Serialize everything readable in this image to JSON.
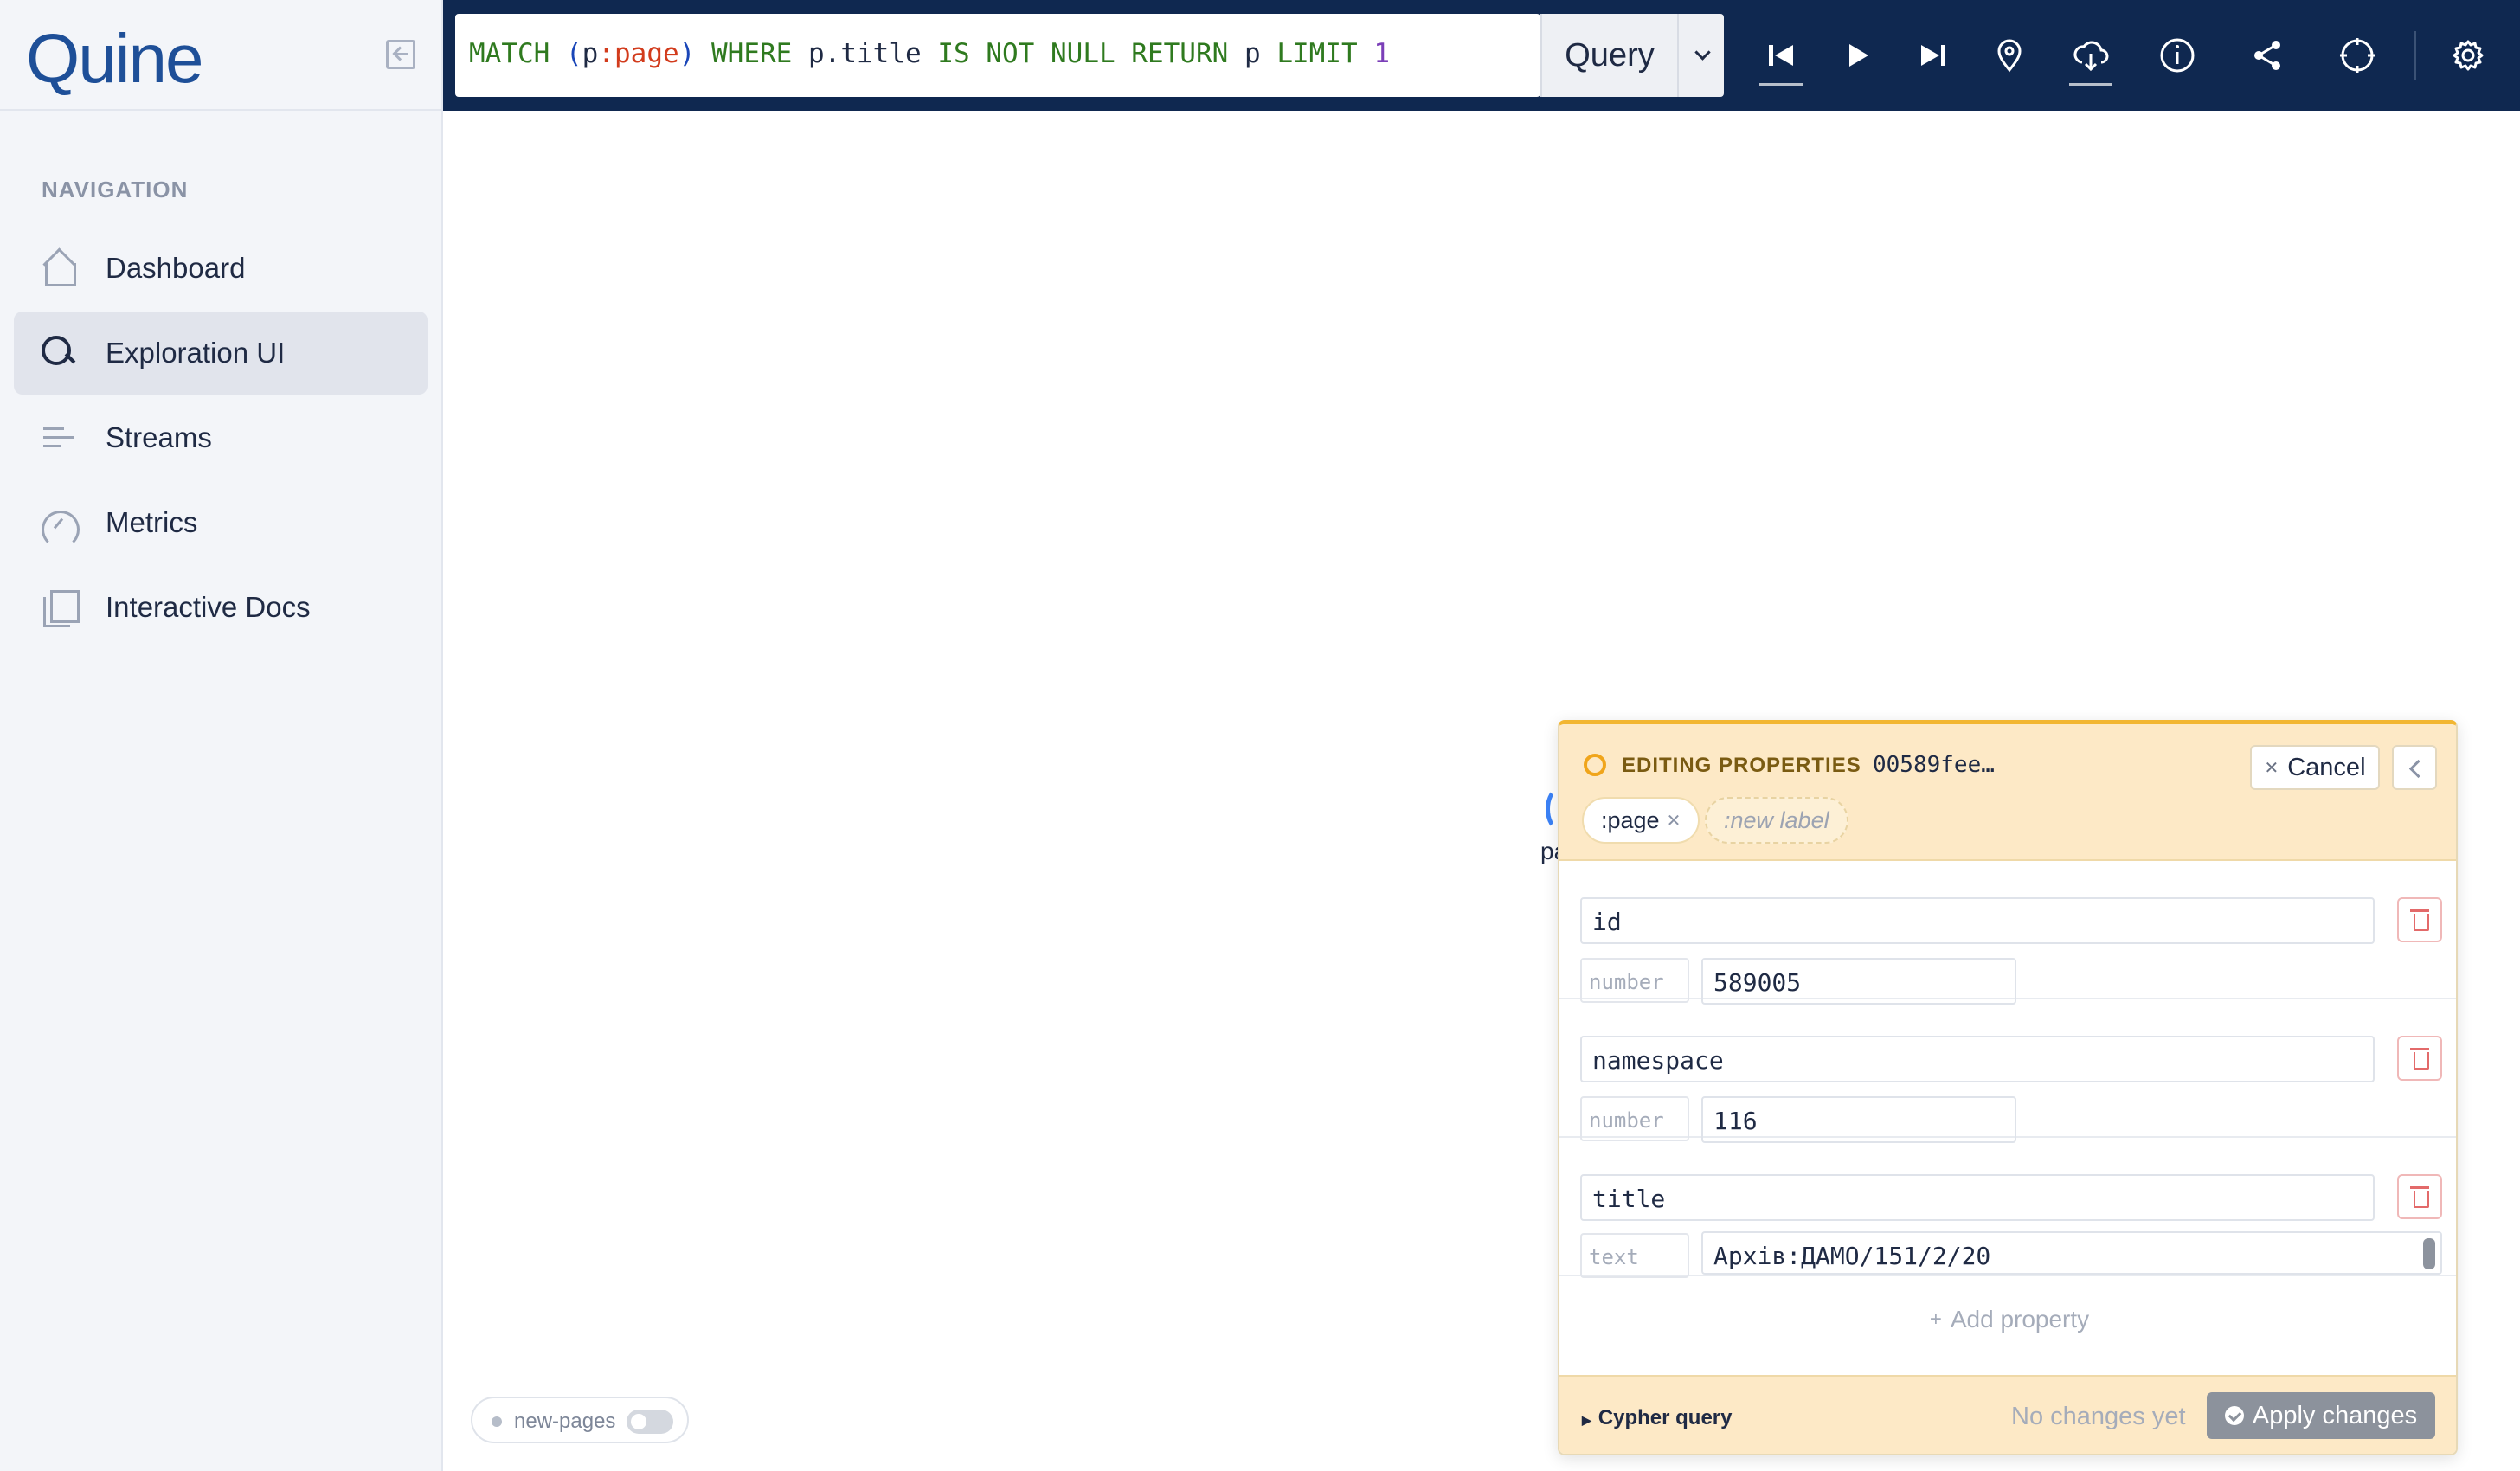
{
  "app": {
    "logo_text": "Quine"
  },
  "sidebar": {
    "heading": "NAVIGATION",
    "items": [
      {
        "label": "Dashboard",
        "icon": "home-icon",
        "active": false
      },
      {
        "label": "Exploration UI",
        "icon": "search-icon",
        "active": true
      },
      {
        "label": "Streams",
        "icon": "streams-icon",
        "active": false
      },
      {
        "label": "Metrics",
        "icon": "gauge-icon",
        "active": false
      },
      {
        "label": "Interactive Docs",
        "icon": "docs-icon",
        "active": false
      }
    ]
  },
  "toolbar": {
    "query_text": "MATCH (p:page) WHERE p.title IS NOT NULL RETURN p LIMIT 1",
    "query_button_label": "Query",
    "icons": [
      "skip-back-icon",
      "play-icon",
      "skip-forward-icon",
      "location-pin-icon",
      "cloud-download-icon",
      "info-icon",
      "share-icon",
      "crosshair-icon",
      "settings-icon"
    ]
  },
  "canvas": {
    "node_label_partial": "pa",
    "toggle": {
      "label": "new-pages",
      "on": false
    }
  },
  "editor": {
    "title": "EDITING PROPERTIES",
    "node_id": "00589fee…",
    "cancel_label": "Cancel",
    "labels": [
      ":page"
    ],
    "new_label_placeholder": ":new label",
    "properties": [
      {
        "key": "id",
        "type": "number",
        "value": "589005"
      },
      {
        "key": "namespace",
        "type": "number",
        "value": "116"
      },
      {
        "key": "title",
        "type": "text",
        "value": "Архів:ДАМО/151/2/20"
      }
    ],
    "add_property_label": "Add property",
    "cypher_query_label": "Cypher query",
    "status_text": "No changes yet",
    "apply_label": "Apply changes"
  },
  "colors": {
    "topbar": "#0f2850",
    "accent_logo": "#1e4f98",
    "editing_header": "#fde9c6",
    "editing_border": "#f2b632",
    "delete_red": "#e36a6a"
  }
}
